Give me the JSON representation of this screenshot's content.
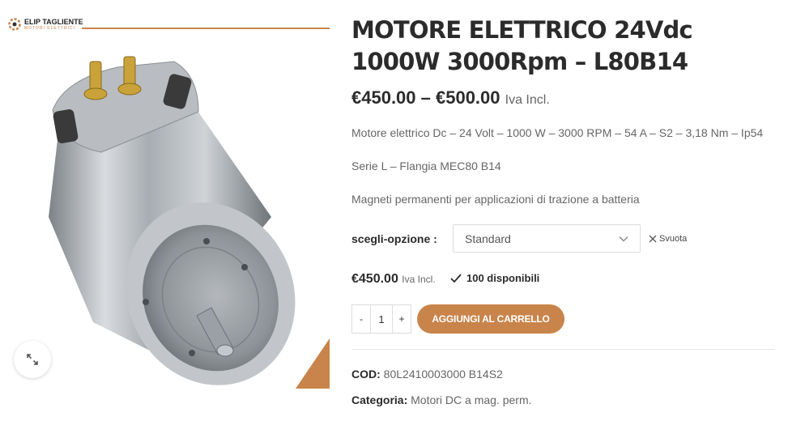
{
  "brand": {
    "name": "ELIP TAGLIENTE",
    "tagline": "MOTORI ELETTRICI"
  },
  "product": {
    "title": "MOTORE ELETTRICO 24Vdc 1000W 3000Rpm – L80B14",
    "price_range": "€450.00 – €500.00",
    "vat_label": "Iva Incl.",
    "description": [
      "Motore elettrico Dc – 24 Volt – 1000 W – 3000 RPM – 54 A – S2 – 3,18 Nm – Ip54",
      "Serie L – Flangia MEC80 B14",
      "Magneti permanenti per applicazioni di trazione a batteria"
    ]
  },
  "options": {
    "label": "scegli-opzione",
    "selected": "Standard",
    "clear_label": "Svuota"
  },
  "variation": {
    "price": "€450.00",
    "vat_label": "Iva Incl.",
    "stock": "100 disponibili"
  },
  "cart": {
    "qty_minus": "-",
    "quantity": "1",
    "qty_plus": "+",
    "add_label": "AGGIUNGI AL CARRELLO"
  },
  "meta": {
    "sku_label": "COD:",
    "sku": "80L2410003000 B14S2",
    "category_label": "Categoria:",
    "category": "Motori DC a mag. perm."
  },
  "colors": {
    "accent": "#c8844a",
    "text": "#2b2b2b",
    "muted": "#666666"
  },
  "icons": {
    "zoom": "expand-icon",
    "select": "chevron-down-icon",
    "clear": "close-icon",
    "stock": "checkmark-icon"
  }
}
